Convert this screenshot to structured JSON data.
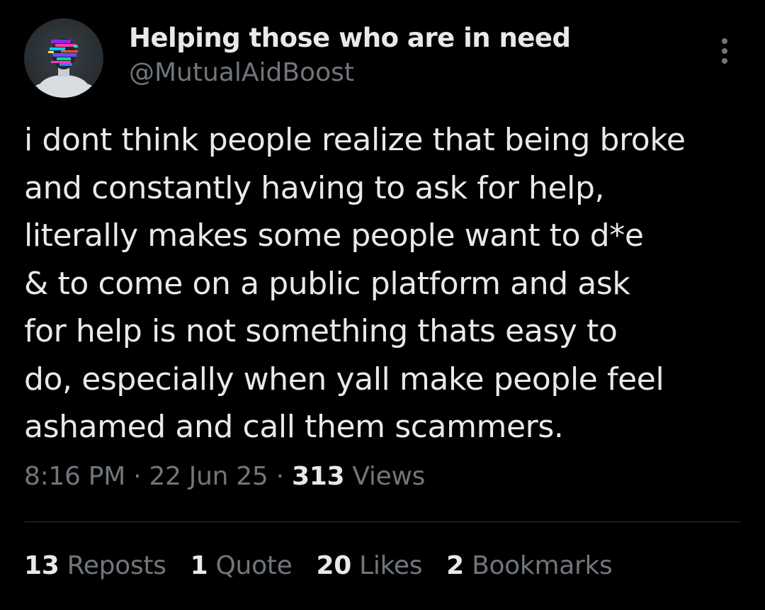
{
  "author": {
    "display_name": "Helping those who are in need",
    "handle": "@MutualAidBoost",
    "avatar_icon": "glitch-portrait-avatar"
  },
  "more_icon": "more-vertical-icon",
  "tweet": {
    "lines": [
      "i dont think people realize that being broke",
      "and constantly having to ask for help,",
      "literally makes some people want to d*e",
      "& to come on a public platform and ask",
      "for help is not something thats easy to",
      "do, especially when yall make people feel",
      "ashamed and call them scammers."
    ]
  },
  "meta": {
    "time": "8:16 PM",
    "separator": "·",
    "date": "22 Jun 25",
    "views_count": "313",
    "views_label": "Views"
  },
  "stats": {
    "reposts_count": "13",
    "reposts_label": "Reposts",
    "quotes_count": "1",
    "quotes_label": "Quote",
    "likes_count": "20",
    "likes_label": "Likes",
    "bookmarks_count": "2",
    "bookmarks_label": "Bookmarks"
  },
  "colors": {
    "background": "#000000",
    "primary_text": "#e7e9ea",
    "secondary_text": "#71767b",
    "divider": "#2f3336"
  }
}
